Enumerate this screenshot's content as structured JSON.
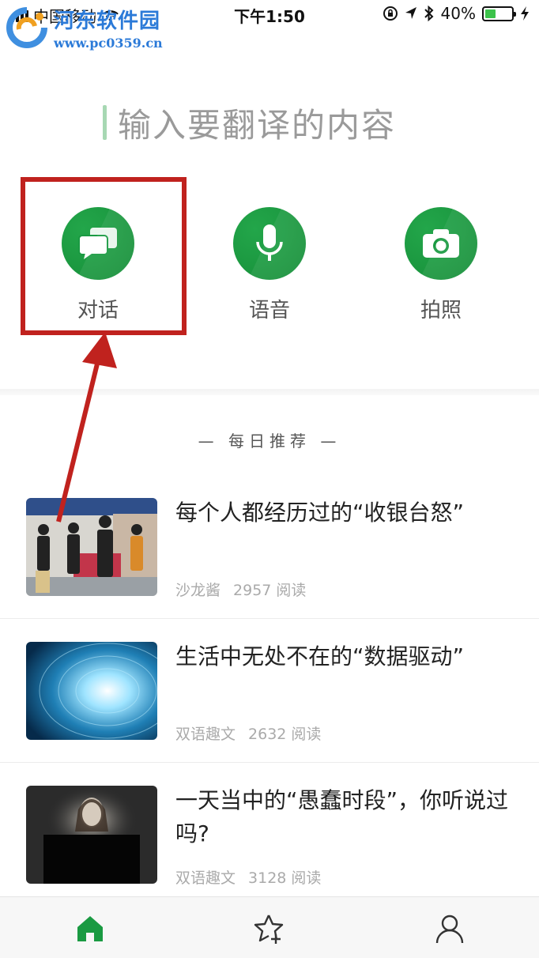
{
  "status_bar": {
    "carrier": "中国移动",
    "time": "下午1:50",
    "battery": "40%",
    "battery_level": 0.4
  },
  "watermark": {
    "name": "河东软件园",
    "url": "www.pc0359.cn"
  },
  "search": {
    "placeholder": "输入要翻译的内容"
  },
  "tools": [
    {
      "label": "对话",
      "icon": "chat-bubbles-icon"
    },
    {
      "label": "语音",
      "icon": "microphone-icon"
    },
    {
      "label": "拍照",
      "icon": "camera-icon"
    }
  ],
  "daily": {
    "heading": "— 每日推荐 —"
  },
  "articles": [
    {
      "title": "每个人都经历过的“收银台怒”",
      "source": "沙龙酱",
      "reads": "2957 阅读"
    },
    {
      "title": "生活中无处不在的“数据驱动”",
      "source": "双语趣文",
      "reads": "2632 阅读"
    },
    {
      "title": "一天当中的“愚蠢时段”，你听说过吗?",
      "source": "双语趣文",
      "reads": "3128 阅读"
    }
  ],
  "tabbar": {
    "items": [
      {
        "icon": "home-icon"
      },
      {
        "icon": "star-add-icon"
      },
      {
        "icon": "user-icon"
      }
    ]
  },
  "colors": {
    "brand_green": "#1a9a42",
    "highlight_red": "#c0221e",
    "watermark_blue": "#2b7ad8"
  }
}
